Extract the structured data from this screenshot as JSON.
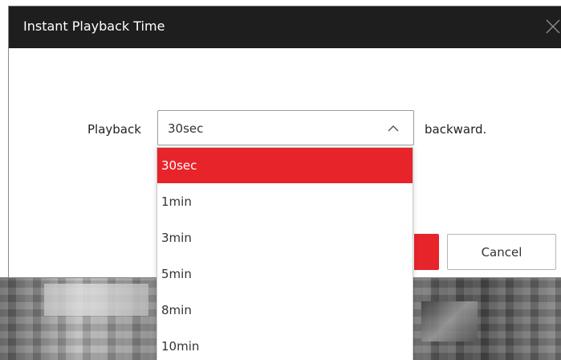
{
  "dialog": {
    "title": "Instant Playback Time",
    "close_icon": "close-icon"
  },
  "form": {
    "prefix_label": "Playback",
    "suffix_label": "backward.",
    "selected_value": "30sec",
    "chevron_icon": "chevron-up-icon"
  },
  "dropdown": {
    "options": [
      {
        "label": "30sec",
        "selected": true
      },
      {
        "label": "1min",
        "selected": false
      },
      {
        "label": "3min",
        "selected": false
      },
      {
        "label": "5min",
        "selected": false
      },
      {
        "label": "8min",
        "selected": false
      },
      {
        "label": "10min",
        "selected": false
      }
    ]
  },
  "buttons": {
    "cancel_label": "Cancel"
  },
  "colors": {
    "accent": "#e8242b",
    "header_bg": "#1e1e1e"
  }
}
